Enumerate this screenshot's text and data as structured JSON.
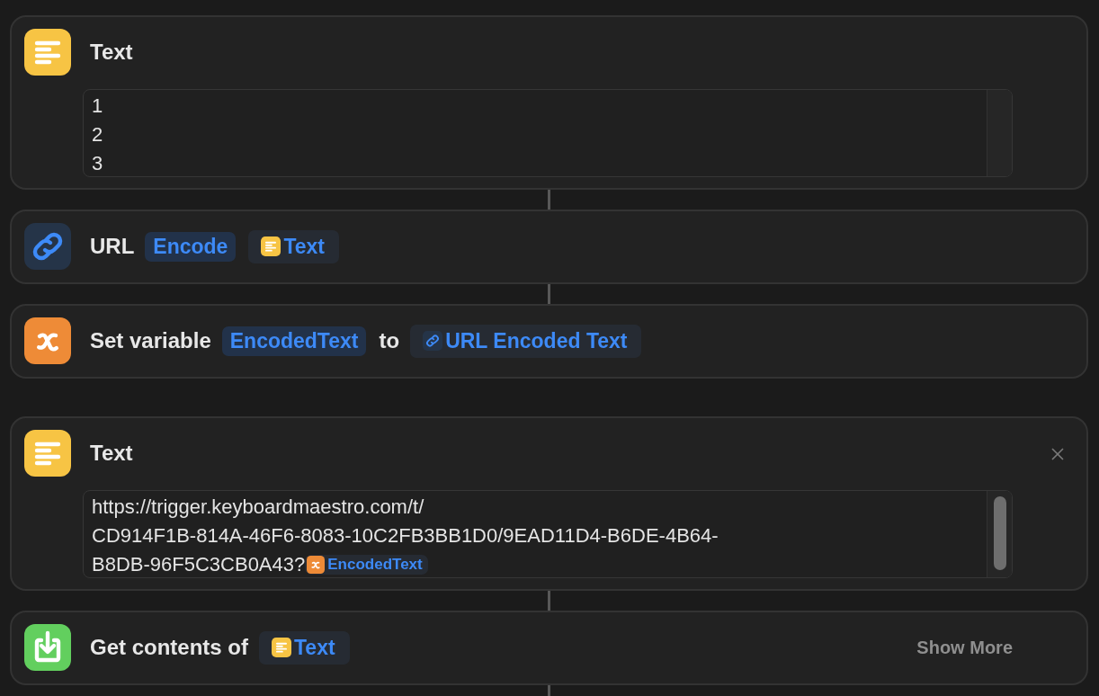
{
  "actions": [
    {
      "kind": "text",
      "title": "Text",
      "closable": false,
      "scrollable": false,
      "connected_below": true,
      "lines": [
        [
          {
            "kind": "text",
            "text": "1"
          }
        ],
        [
          {
            "kind": "text",
            "text": "2"
          }
        ],
        [
          {
            "kind": "text",
            "text": "3"
          }
        ]
      ]
    },
    {
      "kind": "url",
      "connected_below": true,
      "parts": [
        {
          "kind": "label",
          "text": "URL"
        },
        {
          "kind": "token",
          "text": "Encode"
        },
        {
          "kind": "text-token",
          "text": "Text"
        }
      ]
    },
    {
      "kind": "set-variable",
      "connected_below": false,
      "parts": [
        {
          "kind": "label",
          "text": "Set variable"
        },
        {
          "kind": "token",
          "text": "EncodedText"
        },
        {
          "kind": "label",
          "text": "to"
        },
        {
          "kind": "url-token",
          "text": "URL Encoded Text"
        }
      ]
    },
    {
      "kind": "text",
      "title": "Text",
      "closable": true,
      "scrollable": true,
      "connected_below": true,
      "lines": [
        [
          {
            "kind": "text",
            "text": "https://trigger.keyboardmaestro.com/t/"
          }
        ],
        [
          {
            "kind": "text",
            "text": "CD914F1B-814A-46F6-8083-10C2FB3BB1D0/9EAD11D4-B6DE-4B64-"
          }
        ],
        [
          {
            "kind": "text",
            "text": "B8DB-96F5C3CB0A43?"
          },
          {
            "kind": "variable-token",
            "text": "EncodedText"
          }
        ]
      ]
    },
    {
      "kind": "get-contents",
      "connected_below": true,
      "trailing_button": "Show More",
      "parts": [
        {
          "kind": "label",
          "text": "Get contents of"
        },
        {
          "kind": "text-token",
          "text": "Text"
        }
      ]
    }
  ]
}
